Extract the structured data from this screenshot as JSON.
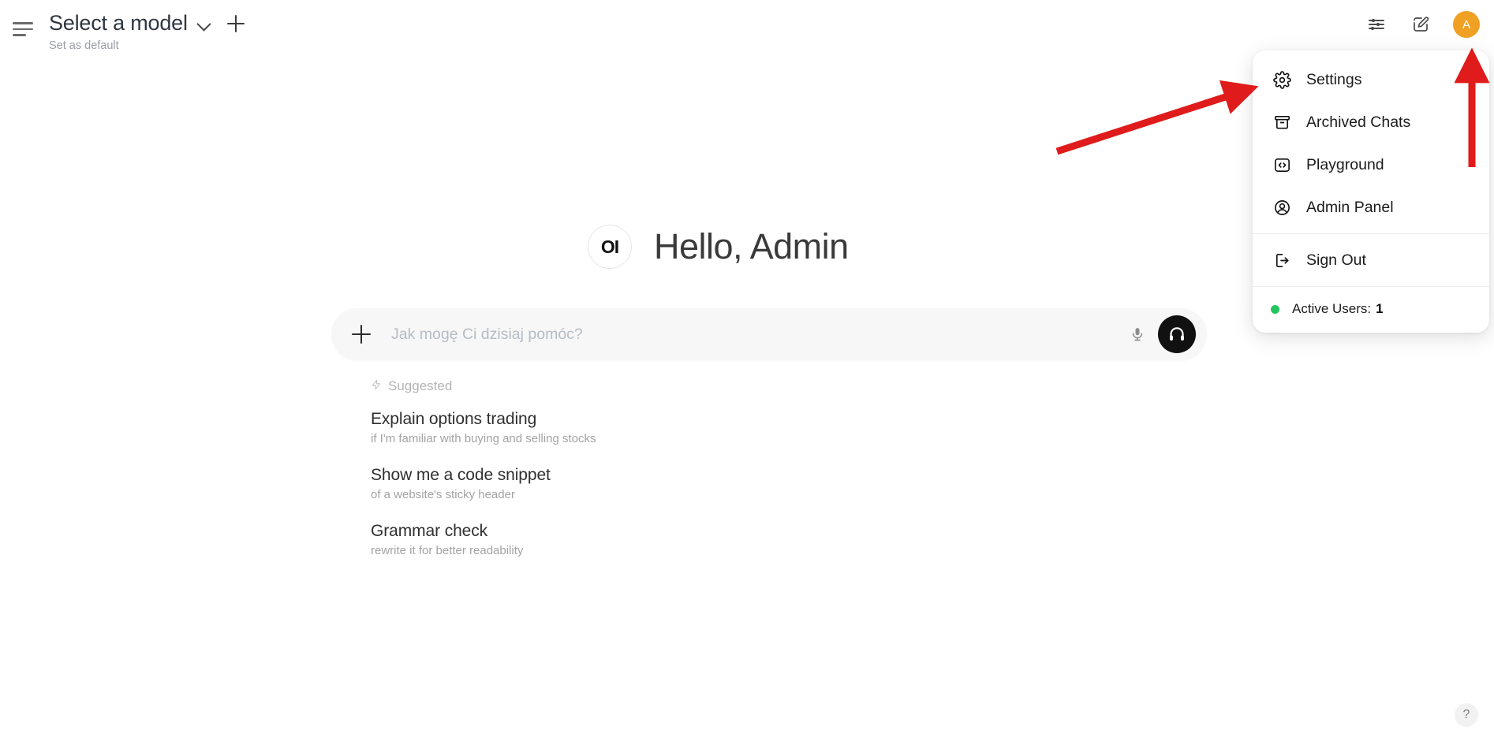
{
  "header": {
    "sidebar_toggle_name": "sidebar-toggle",
    "model_selector_label": "Select a model",
    "set_as_default_label": "Set as default",
    "new_chat_label": "+"
  },
  "top_right": {
    "controls_icon": "sliders-icon",
    "new_chat_icon": "pencil-square-icon",
    "avatar_initial": "A",
    "avatar_color": "#f0a022"
  },
  "user_menu": {
    "items": [
      {
        "label": "Settings",
        "icon": "gear-icon"
      },
      {
        "label": "Archived Chats",
        "icon": "archive-box-icon"
      },
      {
        "label": "Playground",
        "icon": "code-brackets-icon"
      },
      {
        "label": "Admin Panel",
        "icon": "user-circle-icon"
      },
      {
        "label": "Sign Out",
        "icon": "sign-out-icon"
      }
    ],
    "active_users_label": "Active Users:",
    "active_users_count": "1",
    "status_dot_color": "#22c55e"
  },
  "main": {
    "logo_text": "OI",
    "greeting": "Hello, Admin"
  },
  "composer": {
    "placeholder": "Jak mogę Ci dzisiaj pomóc?",
    "value": "",
    "attach_icon": "plus-icon",
    "mic_icon": "microphone-icon",
    "call_icon": "headphones-icon"
  },
  "suggestions": {
    "heading": "Suggested",
    "heading_icon": "lightning-bolt-icon",
    "items": [
      {
        "title": "Explain options trading",
        "subtitle": "if I'm familiar with buying and selling stocks"
      },
      {
        "title": "Show me a code snippet",
        "subtitle": "of a website's sticky header"
      },
      {
        "title": "Grammar check",
        "subtitle": "rewrite it for better readability"
      }
    ]
  },
  "help": {
    "label": "?"
  },
  "annotations": {
    "arrow_color": "#e01b1b",
    "pointing_to": [
      "Settings",
      "avatar"
    ]
  }
}
